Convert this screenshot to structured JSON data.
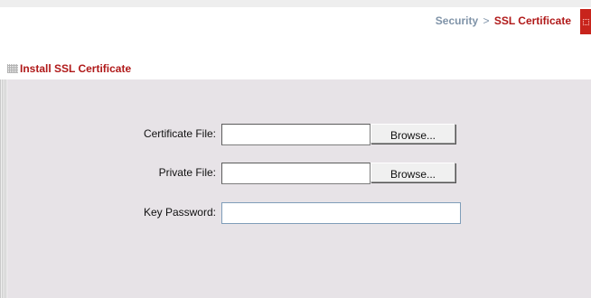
{
  "header": {
    "breadcrumb_parent": "Security",
    "breadcrumb_separator": ">",
    "breadcrumb_current": "SSL Certificate"
  },
  "section": {
    "title": "Install SSL Certificate"
  },
  "form": {
    "certificate_file": {
      "label": "Certificate File:",
      "value": "",
      "browse_label": "Browse..."
    },
    "private_file": {
      "label": "Private File:",
      "value": "",
      "browse_label": "Browse..."
    },
    "key_password": {
      "label": "Key Password:",
      "value": ""
    }
  },
  "icons": {
    "section_icon": "grid-icon",
    "corner_tab_icon": "dotted-square-icon"
  },
  "colors": {
    "accent_red": "#b01919",
    "breadcrumb_parent": "#7f93a8",
    "panel_background": "#e7e3e7",
    "input_border": "#7f9db9"
  }
}
